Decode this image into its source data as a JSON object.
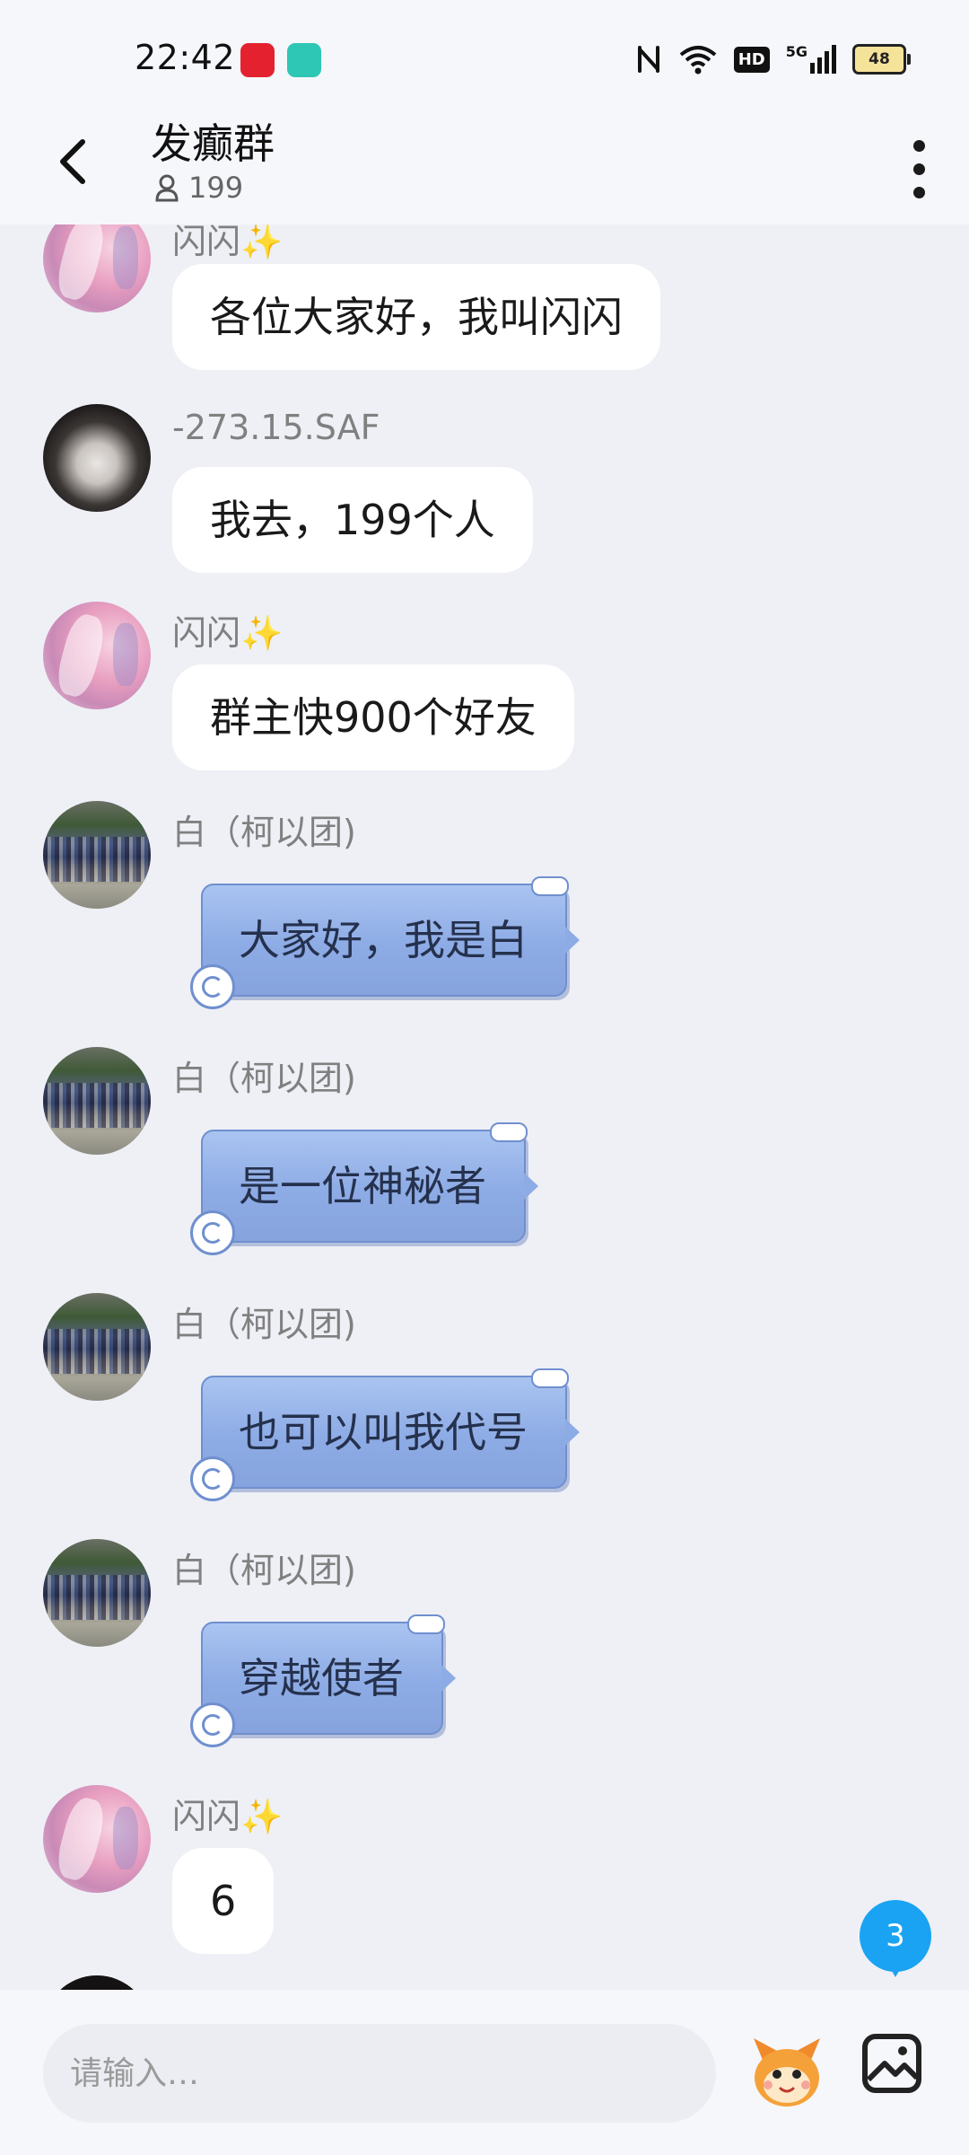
{
  "status_bar": {
    "time": "22:42",
    "network": "5G",
    "hd": "HD",
    "battery": "48",
    "icons": [
      "nfc-icon",
      "wifi-icon",
      "hd-icon",
      "signal-icon",
      "battery-icon"
    ]
  },
  "header": {
    "title": "发癫群",
    "member_count": "199",
    "icons": [
      "back-arrow-icon",
      "person-icon",
      "more-vert-icon"
    ]
  },
  "messages": [
    {
      "sender": "闪闪✨",
      "text": "各位大家好，我叫闪闪",
      "style": "plain"
    },
    {
      "sender": "-273.15.SAF",
      "text": "我去，199个人",
      "style": "plain"
    },
    {
      "sender": "闪闪✨",
      "text": "群主快900个好友",
      "style": "plain"
    },
    {
      "sender": "白（柯以团)",
      "text": "大家好，我是白",
      "style": "decorated-blue"
    },
    {
      "sender": "白（柯以团)",
      "text": "是一位神秘者",
      "style": "decorated-blue"
    },
    {
      "sender": "白（柯以团)",
      "text": "也可以叫我代号",
      "style": "decorated-blue"
    },
    {
      "sender": "白（柯以团)",
      "text": "穿越使者",
      "style": "decorated-blue"
    },
    {
      "sender": "闪闪✨",
      "text": "6",
      "style": "plain"
    }
  ],
  "unread_badge": "3",
  "input_bar": {
    "placeholder": "请输入…",
    "icons": [
      "mascot-icon",
      "gallery-icon"
    ]
  },
  "colors": {
    "chat_background": "#eef0f6",
    "bubble": "#ffffff",
    "decorated_bubble": "#8dabe5",
    "unread_badge": "#1aa3f2"
  }
}
